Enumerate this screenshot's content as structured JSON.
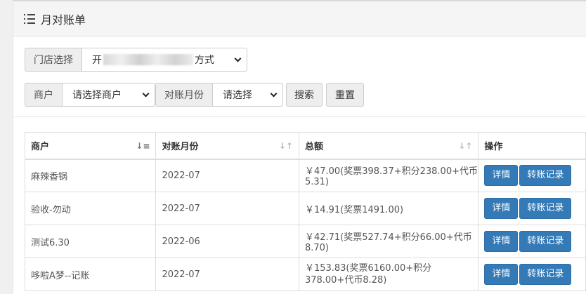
{
  "header": {
    "title": "月对账单",
    "icon": "list-icon"
  },
  "filters": {
    "store_label": "门店选择",
    "store_value_prefix": "开",
    "store_value_suffix": "方式",
    "merchant_label": "商户",
    "merchant_value": "请选择商户",
    "month_label": "对账月份",
    "month_value": "请选择",
    "search_label": "搜索",
    "reset_label": "重置"
  },
  "table": {
    "columns": [
      "商户",
      "对账月份",
      "总额",
      "操作"
    ],
    "rows": [
      {
        "merchant": "麻辣香锅",
        "month": "2022-07",
        "total": "￥47.00(奖票398.37+积分238.00+代币5.31)",
        "detail": "详情",
        "transfer": "转账记录"
      },
      {
        "merchant": "验收-勿动",
        "month": "2022-07",
        "total": "￥14.91(奖票1491.00)",
        "detail": "详情",
        "transfer": "转账记录"
      },
      {
        "merchant": "测试6.30",
        "month": "2022-06",
        "total": "￥42.71(奖票527.74+积分66.00+代币8.70)",
        "detail": "详情",
        "transfer": "转账记录"
      },
      {
        "merchant": "哆啦A梦--记账",
        "month": "2022-07",
        "total": "￥153.83(奖票6160.00+积分378.00+代币8.28)",
        "detail": "详情",
        "transfer": "转账记录"
      }
    ]
  },
  "colors": {
    "primary": "#337ab7",
    "header_bg": "#f5f5f5"
  }
}
